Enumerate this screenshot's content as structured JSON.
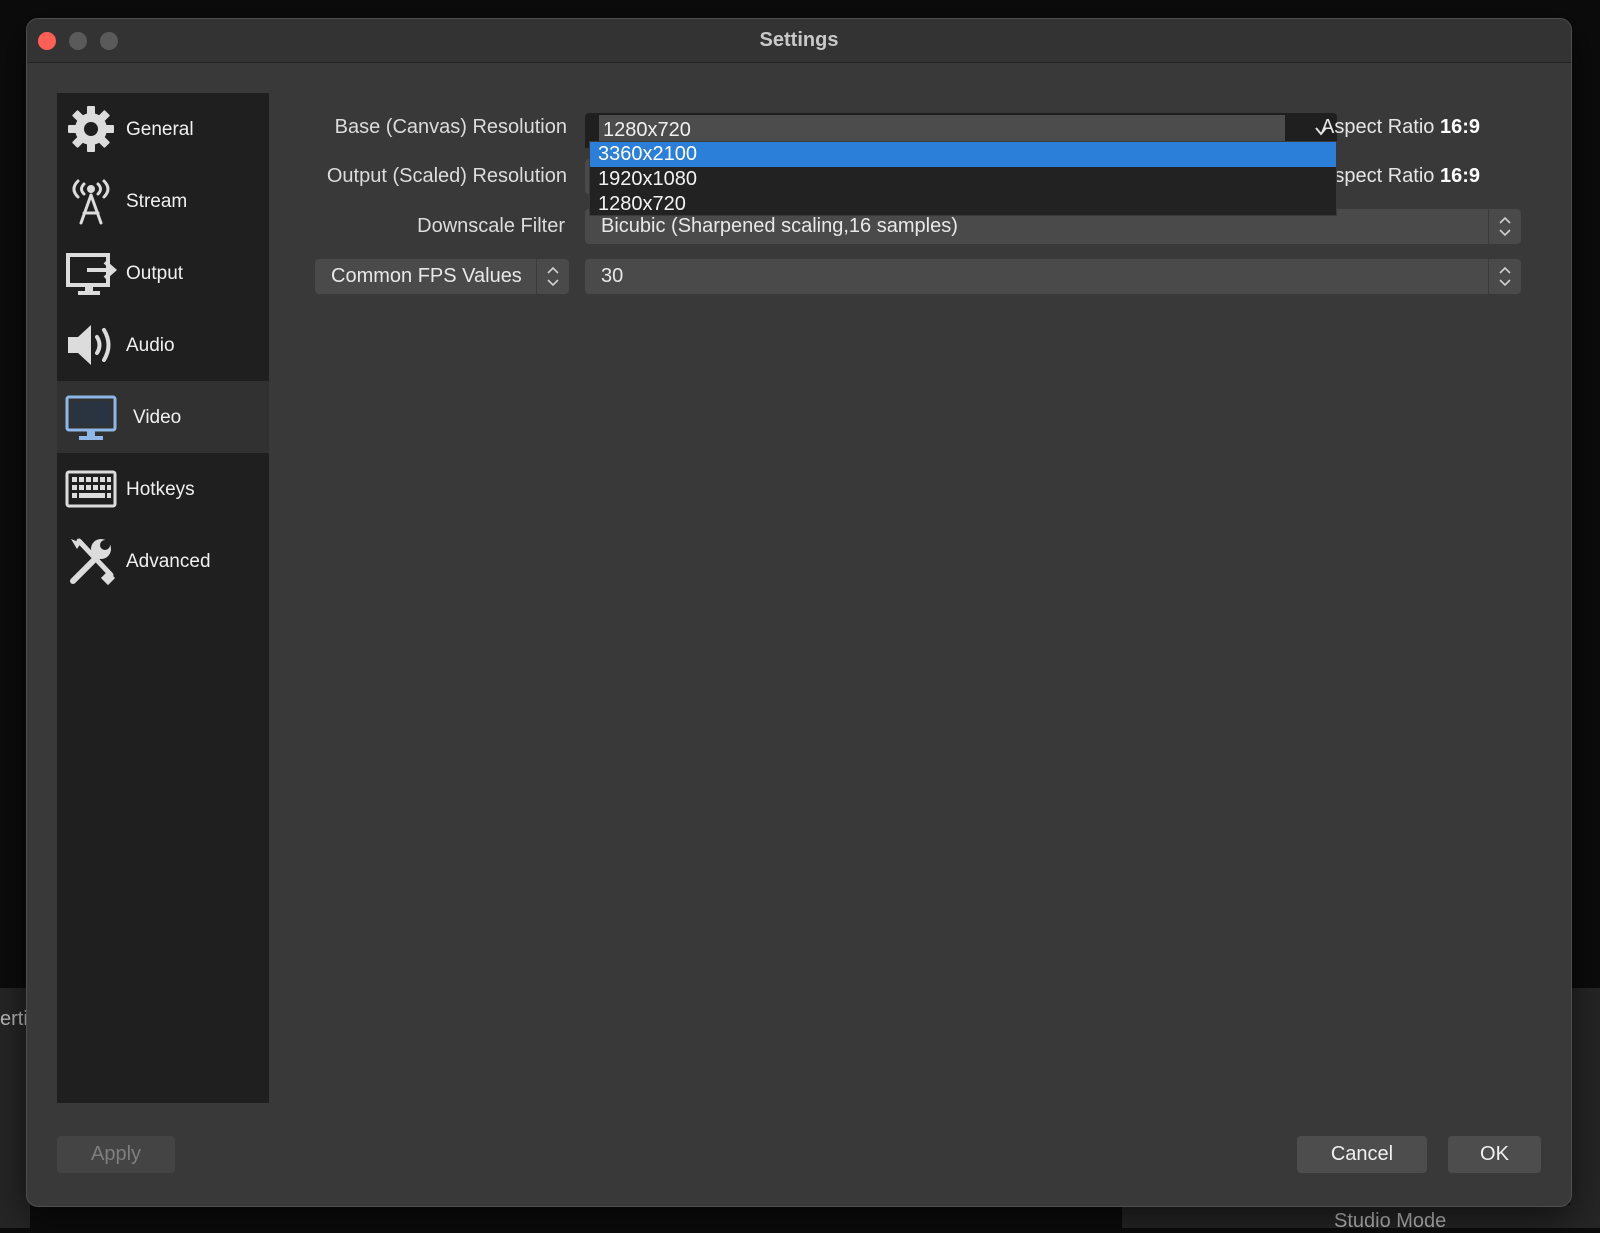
{
  "window": {
    "title": "Settings"
  },
  "sidebar": {
    "items": [
      {
        "label": "General",
        "icon": "gear-icon"
      },
      {
        "label": "Stream",
        "icon": "antenna-icon"
      },
      {
        "label": "Output",
        "icon": "output-icon"
      },
      {
        "label": "Audio",
        "icon": "speaker-icon"
      },
      {
        "label": "Video",
        "icon": "monitor-icon",
        "active": true
      },
      {
        "label": "Hotkeys",
        "icon": "keyboard-icon"
      },
      {
        "label": "Advanced",
        "icon": "tools-icon"
      }
    ]
  },
  "video": {
    "base_label": "Base (Canvas) Resolution",
    "base_value": "1280x720",
    "base_options": [
      "3360x2100",
      "1920x1080",
      "1280x720"
    ],
    "base_selected_option": "3360x2100",
    "output_label": "Output (Scaled) Resolution",
    "aspect_label": "Aspect Ratio",
    "base_aspect_value": "16:9",
    "output_aspect_value": "16:9",
    "downscale_label": "Downscale Filter",
    "downscale_value": "Bicubic (Sharpened scaling,16 samples)",
    "fps_type": "Common FPS Values",
    "fps_value": "30"
  },
  "buttons": {
    "apply": "Apply",
    "cancel": "Cancel",
    "ok": "OK"
  },
  "background": {
    "partial_text_1": "erti",
    "partial_text_2": "Studio Mode"
  },
  "colors": {
    "highlight": "#2b7fd9",
    "close": "#ff5f57",
    "active_icon": "#8fb8e8"
  }
}
